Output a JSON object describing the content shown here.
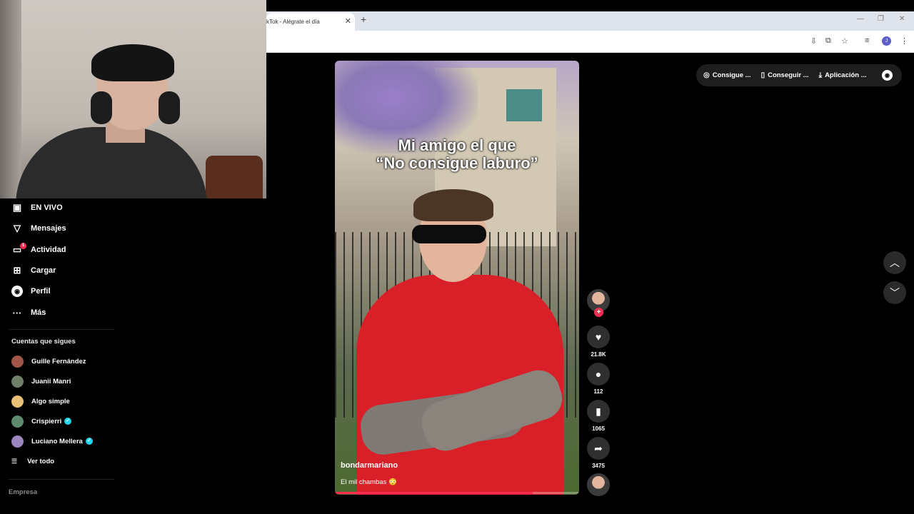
{
  "browser": {
    "tab_title": "kTok - Alégrate el día",
    "tab_close": "✕",
    "new_tab": "+",
    "profile_initial": "J",
    "win_min": "—",
    "win_max": "❐",
    "win_close": "✕"
  },
  "sidebar": {
    "items": [
      {
        "label": "EN VIVO",
        "icon": "live-icon"
      },
      {
        "label": "Mensajes",
        "icon": "messages-icon"
      },
      {
        "label": "Actividad",
        "icon": "activity-icon",
        "badge": "1"
      },
      {
        "label": "Cargar",
        "icon": "upload-icon"
      },
      {
        "label": "Perfil",
        "icon": "profile-icon"
      },
      {
        "label": "Más",
        "icon": "more-icon"
      }
    ],
    "following_title": "Cuentas que sigues",
    "accounts": [
      {
        "name": "Guille Fernández",
        "verified": false,
        "color": "#a0574a"
      },
      {
        "name": "Juanii Manri",
        "verified": false,
        "color": "#6e7f6a"
      },
      {
        "name": "Algo simple",
        "verified": false,
        "color": "#e8c177"
      },
      {
        "name": "Crispierri",
        "verified": true,
        "color": "#5f8a6e"
      },
      {
        "name": "Luciano Mellera",
        "verified": true,
        "color": "#9b86c0"
      }
    ],
    "see_all": "Ver todo",
    "empresa": "Empresa"
  },
  "video": {
    "caption_line1": "Mi amigo el que",
    "caption_line2": "“No consigue laburo”",
    "username": "bondarmariano",
    "description": "El mil chambas 😳",
    "progress": 0.81
  },
  "actions": {
    "likes": "21.8K",
    "comments": "112",
    "saves": "1065",
    "shares": "3475"
  },
  "top_pill": {
    "items": [
      "Consigue ...",
      "Conseguir ...",
      "Aplicación ..."
    ]
  }
}
